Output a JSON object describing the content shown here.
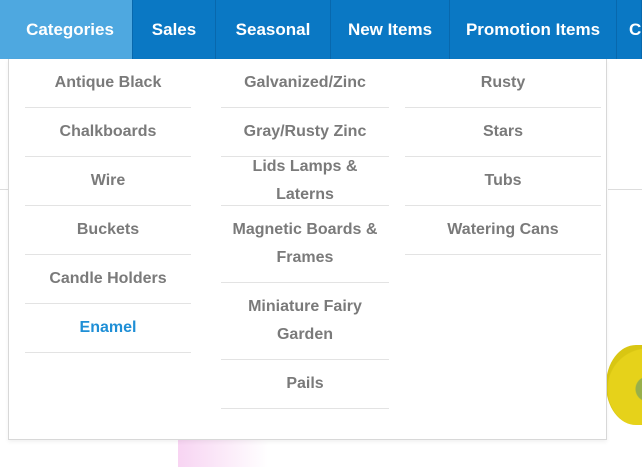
{
  "nav": {
    "tabs": [
      {
        "label": "Categories"
      },
      {
        "label": "Sales"
      },
      {
        "label": "Seasonal"
      },
      {
        "label": "New Items"
      },
      {
        "label": "Promotion Items"
      },
      {
        "label": "C"
      }
    ]
  },
  "dropdown": {
    "col1": [
      "Antique Black",
      "Chalkboards",
      "Wire",
      "Buckets",
      "Candle Holders",
      "Enamel"
    ],
    "col2": [
      "Galvanized/Zinc",
      "Gray/Rusty Zinc",
      "Lids Lamps & Laterns",
      "Magnetic Boards & Frames",
      "Miniature Fairy Garden",
      "Pails"
    ],
    "col3": [
      "Rusty",
      "Stars",
      "Tubs",
      "Watering Cans"
    ]
  },
  "colors": {
    "nav_bg": "#0a78c4",
    "nav_active": "#4ea8e0",
    "item_text": "#7a7a7a",
    "item_active": "#1f8fd6"
  }
}
